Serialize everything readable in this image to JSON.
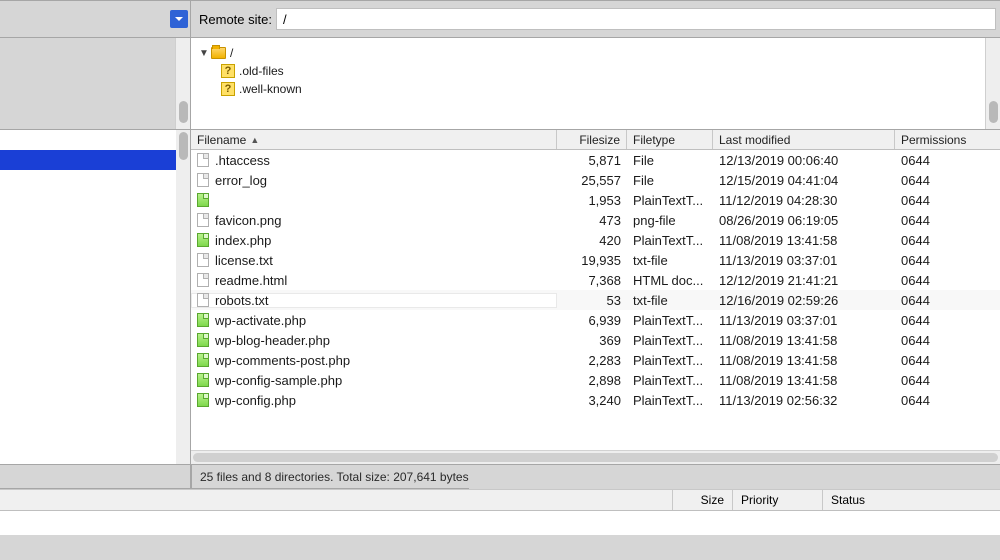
{
  "remote_site": {
    "label": "Remote site:",
    "path": "/"
  },
  "tree": {
    "root": "/",
    "children": [
      {
        "name": ".old-files"
      },
      {
        "name": ".well-known"
      }
    ]
  },
  "columns": {
    "filename": "Filename",
    "filesize": "Filesize",
    "filetype": "Filetype",
    "last_modified": "Last modified",
    "permissions": "Permissions"
  },
  "files": [
    {
      "name": ".htaccess",
      "size": "5,871",
      "type": "File",
      "mod": "12/13/2019 00:06:40",
      "perm": "0644",
      "icon": "plain"
    },
    {
      "name": "error_log",
      "size": "25,557",
      "type": "File",
      "mod": "12/15/2019 04:41:04",
      "perm": "0644",
      "icon": "plain"
    },
    {
      "name": "",
      "size": "1,953",
      "type": "PlainTextT...",
      "mod": "11/12/2019 04:28:30",
      "perm": "0644",
      "icon": "green"
    },
    {
      "name": "favicon.png",
      "size": "473",
      "type": "png-file",
      "mod": "08/26/2019 06:19:05",
      "perm": "0644",
      "icon": "plain"
    },
    {
      "name": "index.php",
      "size": "420",
      "type": "PlainTextT...",
      "mod": "11/08/2019 13:41:58",
      "perm": "0644",
      "icon": "green"
    },
    {
      "name": "license.txt",
      "size": "19,935",
      "type": "txt-file",
      "mod": "11/13/2019 03:37:01",
      "perm": "0644",
      "icon": "plain"
    },
    {
      "name": "readme.html",
      "size": "7,368",
      "type": "HTML doc...",
      "mod": "12/12/2019 21:41:21",
      "perm": "0644",
      "icon": "plain"
    },
    {
      "name": "robots.txt",
      "size": "53",
      "type": "txt-file",
      "mod": "12/16/2019 02:59:26",
      "perm": "0644",
      "icon": "plain",
      "highlight": true
    },
    {
      "name": "wp-activate.php",
      "size": "6,939",
      "type": "PlainTextT...",
      "mod": "11/13/2019 03:37:01",
      "perm": "0644",
      "icon": "green"
    },
    {
      "name": "wp-blog-header.php",
      "size": "369",
      "type": "PlainTextT...",
      "mod": "11/08/2019 13:41:58",
      "perm": "0644",
      "icon": "green"
    },
    {
      "name": "wp-comments-post.php",
      "size": "2,283",
      "type": "PlainTextT...",
      "mod": "11/08/2019 13:41:58",
      "perm": "0644",
      "icon": "green"
    },
    {
      "name": "wp-config-sample.php",
      "size": "2,898",
      "type": "PlainTextT...",
      "mod": "11/08/2019 13:41:58",
      "perm": "0644",
      "icon": "green"
    },
    {
      "name": "wp-config.php",
      "size": "3,240",
      "type": "PlainTextT...",
      "mod": "11/13/2019 02:56:32",
      "perm": "0644",
      "icon": "green"
    }
  ],
  "status": "25 files and 8 directories. Total size: 207,641 bytes",
  "queue_columns": {
    "size": "Size",
    "priority": "Priority",
    "status": "Status"
  }
}
